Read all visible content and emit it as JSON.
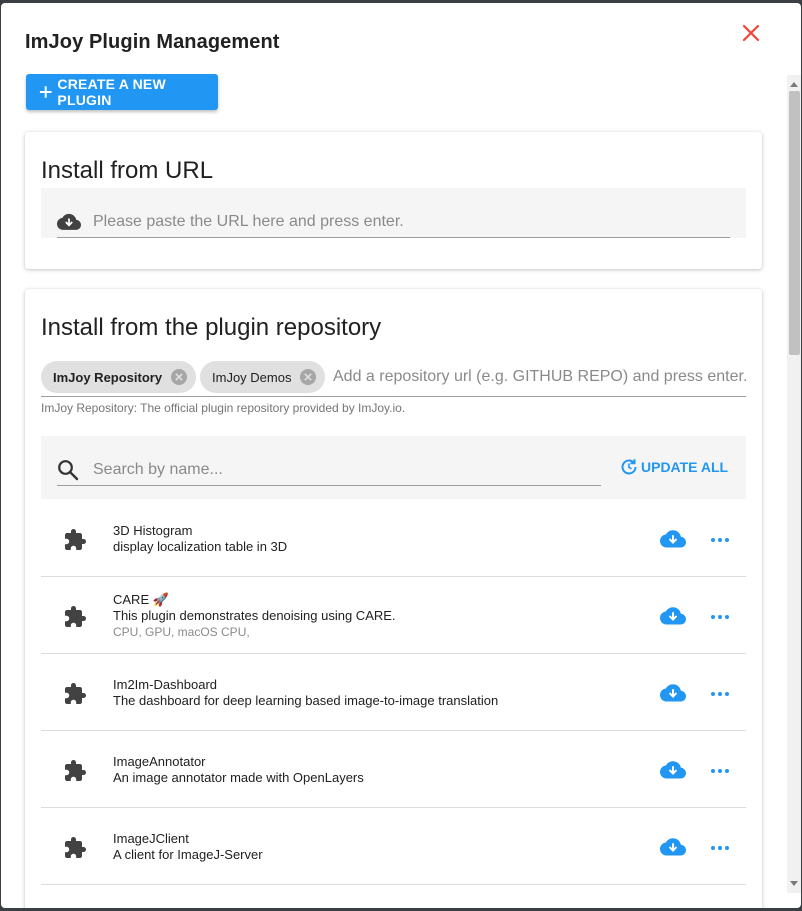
{
  "dialog": {
    "title": "ImJoy Plugin Management",
    "close_icon": "close-icon"
  },
  "toolbar": {
    "create_label": "CREATE A NEW PLUGIN"
  },
  "install_url": {
    "title": "Install from URL",
    "placeholder": "Please paste the URL here and press enter."
  },
  "repository": {
    "title": "Install from the plugin repository",
    "chips": [
      {
        "label": "ImJoy Repository"
      },
      {
        "label": "ImJoy Demos"
      }
    ],
    "input_placeholder": "Add a repository url (e.g. GITHUB REPO) and press enter.",
    "hint": "ImJoy Repository: The official plugin repository provided by ImJoy.io.",
    "search_placeholder": "Search by name...",
    "update_all_label": "UPDATE ALL"
  },
  "plugins": [
    {
      "name": "3D Histogram",
      "description": "display localization table in 3D",
      "tags": ""
    },
    {
      "name": "CARE 🚀",
      "description": "This plugin demonstrates denoising using CARE.",
      "tags": "CPU, GPU, macOS CPU,"
    },
    {
      "name": "Im2Im-Dashboard",
      "description": "The dashboard for deep learning based image-to-image translation",
      "tags": ""
    },
    {
      "name": "ImageAnnotator",
      "description": "An image annotator made with OpenLayers",
      "tags": ""
    },
    {
      "name": "ImageJClient",
      "description": "A client for ImageJ-Server",
      "tags": ""
    }
  ],
  "colors": {
    "accent": "#2196f3",
    "close": "#f44336",
    "icon_dark": "#424242"
  }
}
